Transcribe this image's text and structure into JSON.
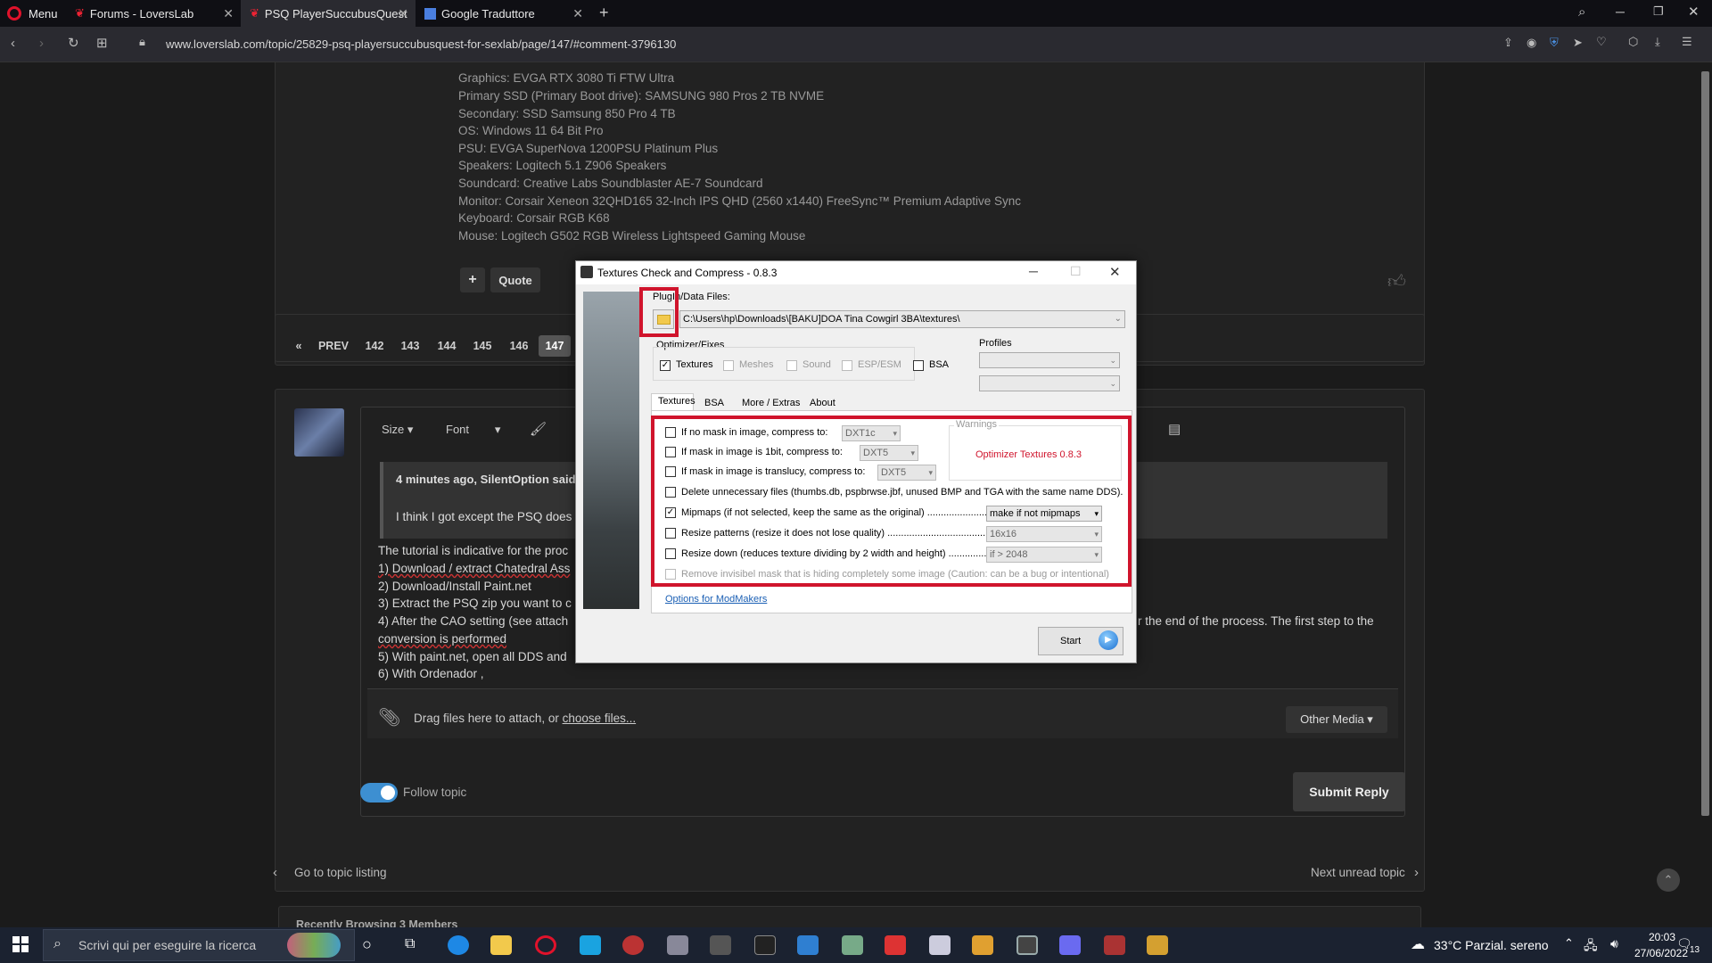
{
  "browser": {
    "menu_label": "Menu",
    "tabs": [
      {
        "label": "Forums - LoversLab"
      },
      {
        "label": "PSQ PlayerSuccubusQuest"
      },
      {
        "label": "Google Traduttore"
      }
    ],
    "url": "www.loverslab.com/topic/25829-psq-playersuccubusquest-for-sexlab/page/147/#comment-3796130"
  },
  "specs": [
    "Graphics: EVGA RTX 3080 Ti FTW Ultra",
    "Primary SSD (Primary Boot drive): SAMSUNG 980 Pros 2 TB NVME",
    "Secondary: SSD Samsung 850 Pro 4 TB",
    "OS: Windows 11 64 Bit Pro",
    "PSU: EVGA SuperNova 1200PSU Platinum Plus",
    "Speakers: Logitech 5.1 Z906 Speakers",
    "Soundcard: Creative Labs Soundblaster AE-7 Soundcard",
    "Monitor: Corsair Xeneon 32QHD165 32-Inch IPS QHD (2560 x1440) FreeSync™ Premium Adaptive Sync",
    "Keyboard: Corsair RGB K68",
    "Mouse: Logitech G502 RGB Wireless Lightspeed Gaming Mouse"
  ],
  "post_actions": {
    "add": "+",
    "quote": "Quote"
  },
  "pagination": {
    "first": "«",
    "prev": "PREV",
    "pages": [
      "142",
      "143",
      "144",
      "145",
      "146",
      "147"
    ],
    "current": "147"
  },
  "editor": {
    "size": "Size",
    "font": "Font",
    "quote_header": "4 minutes ago, SilentOption said:",
    "quote_text": "I think I got except the PSQ does",
    "lines": [
      "The tutorial is indicative for the proc",
      "1) Download / extract Chatedral Ass",
      "2) Download/Install Paint.net",
      "3) Extract the PSQ zip you want to c",
      "4) After the CAO setting (see attach",
      "conversion is performed",
      "5) With paint.net, open all DDS and",
      "6) With Ordenador ,"
    ],
    "line_tail": "r the end of the process. The first step to the",
    "attach_text": "Drag files here to attach, or ",
    "attach_link": "choose files...",
    "other_media": "Other Media ▾"
  },
  "follow": "Follow topic",
  "submit": "Submit Reply",
  "nav": {
    "back": "Go to topic listing",
    "next": "Next unread topic"
  },
  "recently": "Recently Browsing   3 Members",
  "dialog": {
    "title": "Textures Check and Compress - 0.8.3",
    "plugin_label": "PlugIn/Data Files:",
    "path": "C:\\Users\\hp\\Downloads\\[BAKU]DOA Tina Cowgirl 3BA\\textures\\",
    "optimizer_label": "Optimizer/Fixes",
    "opts": {
      "textures": "Textures",
      "meshes": "Meshes",
      "sound": "Sound",
      "esp": "ESP/ESM",
      "bsa": "BSA"
    },
    "profiles": "Profiles",
    "tabs": [
      "Textures",
      "BSA",
      "More / Extras",
      "About"
    ],
    "warnings": "Warnings",
    "warning_text": "Optimizer Textures 0.8.3",
    "rows": [
      {
        "label": "If no mask in image, compress to:",
        "combo": "DXT1c"
      },
      {
        "label": "If mask in image is 1bit, compress to:",
        "combo": "DXT5"
      },
      {
        "label": "If mask in image is translucy, compress to:",
        "combo": "DXT5"
      },
      {
        "label": "Delete unnecessary files (thumbs.db, pspbrwse.jbf, unused BMP and TGA with the same name DDS)."
      },
      {
        "label": "Mipmaps (if not selected, keep the same as the original) ......................",
        "combo": "make if not mipmaps"
      },
      {
        "label": "Resize patterns (resize it does not lose quality) .......................................",
        "combo": "16x16"
      },
      {
        "label": "Resize down (reduces texture dividing by 2 width and height) .................",
        "combo": "if > 2048"
      },
      {
        "label": "Remove invisibel mask that is hiding completely some image (Caution: can be a bug or intentional)"
      }
    ],
    "modmakers": "Options for ModMakers",
    "start": "Start"
  },
  "taskbar": {
    "search": "Scrivi qui per eseguire la ricerca",
    "weather": "33°C  Parzial. sereno",
    "time": "20:03",
    "date": "27/06/2022",
    "notif": "13"
  },
  "colors": {
    "accent": "#d0142c",
    "toggle": "#3d8fd1"
  }
}
